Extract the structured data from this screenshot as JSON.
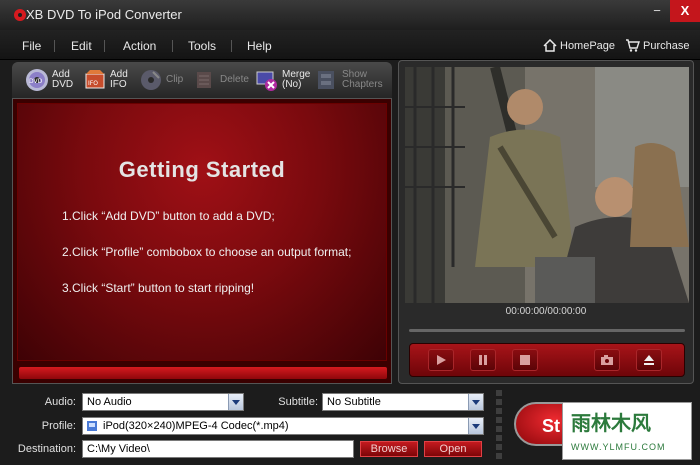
{
  "window": {
    "title": "XB DVD To iPod Converter",
    "minimize_glyph": "−",
    "close_glyph": "X"
  },
  "menu": {
    "items": [
      "File",
      "Edit",
      "Action",
      "Tools",
      "Help"
    ],
    "homepage_label": "HomePage",
    "purchase_label": "Purchase"
  },
  "toolbar": {
    "add_dvd": "Add\nDVD",
    "add_ifo": "Add\nIFO",
    "clip": "Clip",
    "delete": "Delete",
    "merge": "Merge\n(No)",
    "show_chapters": "Show\nChapters"
  },
  "getting_started": {
    "title": "Getting  Started",
    "step1": "1.Click “Add DVD” button to add a DVD;",
    "step2": "2.Click “Profile” combobox to choose an output format;",
    "step3": "3.Click “Start” button to start ripping!"
  },
  "preview": {
    "time": "00:00:00/00:00:00"
  },
  "form": {
    "audio_label": "Audio:",
    "audio_value": "No Audio",
    "subtitle_label": "Subtitle:",
    "subtitle_value": "No Subtitle",
    "profile_label": "Profile:",
    "profile_value": "iPod(320×240)MPEG-4 Codec(*.mp4)",
    "destination_label": "Destination:",
    "destination_value": "C:\\My Video\\",
    "browse_label": "Browse",
    "open_label": "Open",
    "start_label": "St"
  },
  "watermark": {
    "text": "雨林木风",
    "url": "WWW.YLMFU.COM"
  },
  "colors": {
    "accent_red": "#c4161c",
    "panel_red": "#8e070b",
    "watermark_green": "#2c7a3c"
  }
}
